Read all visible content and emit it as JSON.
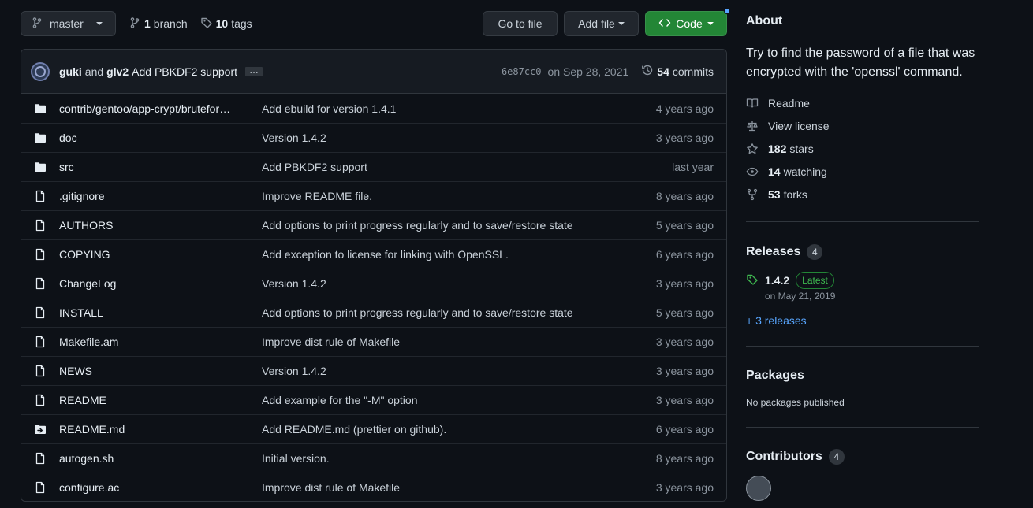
{
  "toolbar": {
    "branch_name": "master",
    "branch_count": "1",
    "branch_label": "branch",
    "tag_count": "10",
    "tag_label": "tags",
    "go_to_file": "Go to file",
    "add_file": "Add file",
    "code": "Code"
  },
  "commit": {
    "author1": "guki",
    "and": "and",
    "author2": "glv2",
    "message": "Add PBKDF2 support",
    "ellipsis": "…",
    "sha": "6e87cc0",
    "date": "on Sep 28, 2021",
    "commits_count": "54",
    "commits_label": "commits"
  },
  "files": [
    {
      "type": "dir",
      "icon": "folder-icon",
      "name": "contrib/gentoo/app-crypt/brutefor…",
      "message": "Add ebuild for version 1.4.1",
      "age": "4 years ago"
    },
    {
      "type": "dir",
      "icon": "folder-icon",
      "name": "doc",
      "message": "Version 1.4.2",
      "age": "3 years ago"
    },
    {
      "type": "dir",
      "icon": "folder-icon",
      "name": "src",
      "message": "Add PBKDF2 support",
      "age": "last year"
    },
    {
      "type": "file",
      "icon": "file-icon",
      "name": ".gitignore",
      "message": "Improve README file.",
      "age": "8 years ago"
    },
    {
      "type": "file",
      "icon": "file-icon",
      "name": "AUTHORS",
      "message": "Add options to print progress regularly and to save/restore state",
      "age": "5 years ago"
    },
    {
      "type": "file",
      "icon": "file-icon",
      "name": "COPYING",
      "message": "Add exception to license for linking with OpenSSL.",
      "age": "6 years ago"
    },
    {
      "type": "file",
      "icon": "file-icon",
      "name": "ChangeLog",
      "message": "Version 1.4.2",
      "age": "3 years ago"
    },
    {
      "type": "file",
      "icon": "file-icon",
      "name": "INSTALL",
      "message": "Add options to print progress regularly and to save/restore state",
      "age": "5 years ago"
    },
    {
      "type": "file",
      "icon": "file-icon",
      "name": "Makefile.am",
      "message": "Improve dist rule of Makefile",
      "age": "3 years ago"
    },
    {
      "type": "file",
      "icon": "file-icon",
      "name": "NEWS",
      "message": "Version 1.4.2",
      "age": "3 years ago"
    },
    {
      "type": "file",
      "icon": "file-icon",
      "name": "README",
      "message": "Add example for the \"-M\" option",
      "age": "3 years ago"
    },
    {
      "type": "symlink",
      "icon": "symlink-file-icon",
      "name": "README.md",
      "message": "Add README.md (prettier on github).",
      "age": "6 years ago"
    },
    {
      "type": "file",
      "icon": "file-icon",
      "name": "autogen.sh",
      "message": "Initial version.",
      "age": "8 years ago"
    },
    {
      "type": "file",
      "icon": "file-icon",
      "name": "configure.ac",
      "message": "Improve dist rule of Makefile",
      "age": "3 years ago"
    }
  ],
  "about": {
    "title": "About",
    "description": "Try to find the password of a file that was encrypted with the 'openssl' command.",
    "readme": "Readme",
    "license": "View license",
    "stars_count": "182",
    "stars_label": "stars",
    "watching_count": "14",
    "watching_label": "watching",
    "forks_count": "53",
    "forks_label": "forks"
  },
  "releases": {
    "title": "Releases",
    "count": "4",
    "latest_version": "1.4.2",
    "latest_badge": "Latest",
    "latest_date": "on May 21, 2019",
    "more_link": "+ 3 releases"
  },
  "packages": {
    "title": "Packages",
    "empty_text": "No packages published"
  },
  "contributors": {
    "title": "Contributors",
    "count": "4"
  },
  "colors": {
    "background": "#0d1117",
    "code_button": "#238636",
    "link": "#58a6ff"
  }
}
